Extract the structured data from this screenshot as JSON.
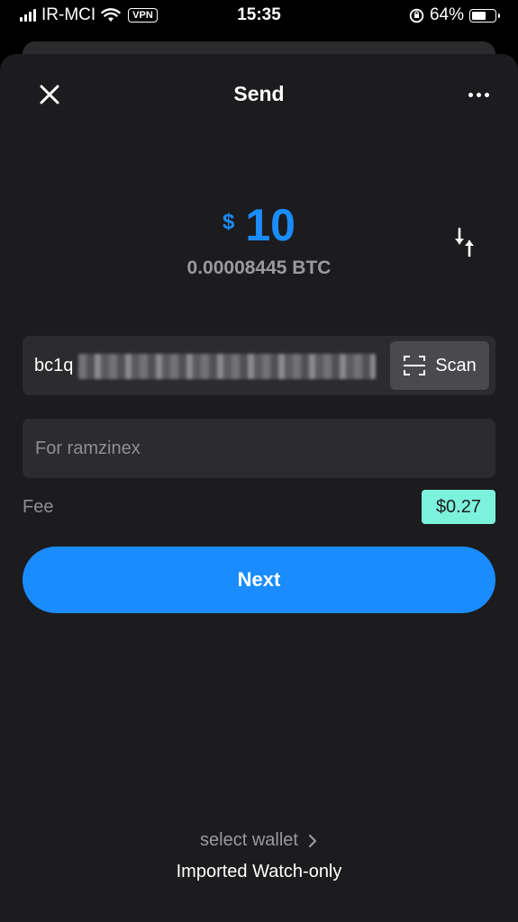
{
  "status_bar": {
    "carrier": "IR-MCI",
    "vpn": "VPN",
    "time": "15:35",
    "battery": "64%",
    "battery_level": 0.64
  },
  "header": {
    "title": "Send",
    "close_icon": "close-icon",
    "more_icon": "more-dots-icon"
  },
  "amount": {
    "currency_sign": "$",
    "value": "10",
    "crypto_value": "0.00008445 BTC",
    "swap_icon": "swap-arrows-icon",
    "accent_color": "#1a8cff"
  },
  "address": {
    "prefix": "bc1q",
    "scan_label": "Scan",
    "scan_icon": "scan-qr-icon"
  },
  "memo": {
    "placeholder": "For ramzinex"
  },
  "fee": {
    "label": "Fee",
    "value": "$0.27",
    "badge_color": "#7cf2dc"
  },
  "actions": {
    "next_label": "Next"
  },
  "wallet": {
    "select_label": "select wallet",
    "name": "Imported Watch-only"
  }
}
